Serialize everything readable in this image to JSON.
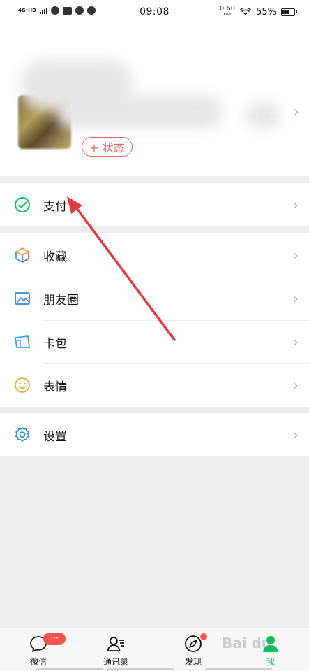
{
  "status_bar": {
    "network": "4G⁺HD",
    "time": "09:08",
    "speed": "0.60",
    "speed_unit": "KB/s",
    "battery": "55%"
  },
  "profile": {
    "status_button": "+ 状态"
  },
  "menu": {
    "pay": "支付",
    "favorites": "收藏",
    "moments": "朋友圈",
    "cards": "卡包",
    "stickers": "表情",
    "settings": "设置"
  },
  "tabbar": {
    "chats": "微信",
    "chats_badge": "···",
    "contacts": "通讯录",
    "discover": "发现",
    "me": "我"
  },
  "watermark": "Bai du",
  "colors": {
    "accent_green": "#07c160",
    "badge_red": "#fa5151",
    "status_red": "#e46a66",
    "annotation_red": "#e8373d"
  }
}
